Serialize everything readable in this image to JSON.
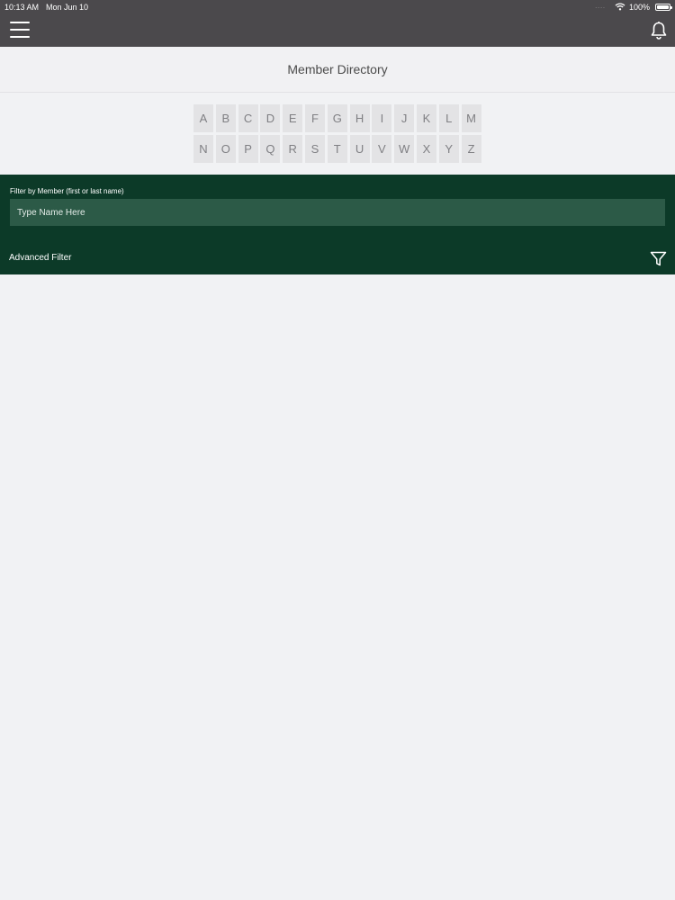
{
  "status_bar": {
    "time": "10:13 AM",
    "date": "Mon Jun 10",
    "dots": "....",
    "battery": "100%",
    "wifi_icon": "wifi-icon",
    "battery_icon": "battery-icon"
  },
  "nav": {
    "menu_icon": "hamburger-menu-icon",
    "notifications_icon": "bell-icon"
  },
  "page": {
    "title": "Member Directory"
  },
  "alphabet": {
    "row1": [
      "A",
      "B",
      "C",
      "D",
      "E",
      "F",
      "G",
      "H",
      "I",
      "J",
      "K",
      "L",
      "M"
    ],
    "row2": [
      "N",
      "O",
      "P",
      "Q",
      "R",
      "S",
      "T",
      "U",
      "V",
      "W",
      "X",
      "Y",
      "Z"
    ]
  },
  "filter": {
    "label": "Filter by Member (first or last name)",
    "value": "",
    "placeholder": "Type Name Here",
    "advanced_label": "Advanced Filter",
    "advanced_icon": "funnel-filter-icon"
  },
  "colors": {
    "status_bar_bg": "#4b494c",
    "filter_panel_bg": "#0c3a28",
    "input_bg": "#2c5a47",
    "page_bg": "#f1f2f4"
  }
}
